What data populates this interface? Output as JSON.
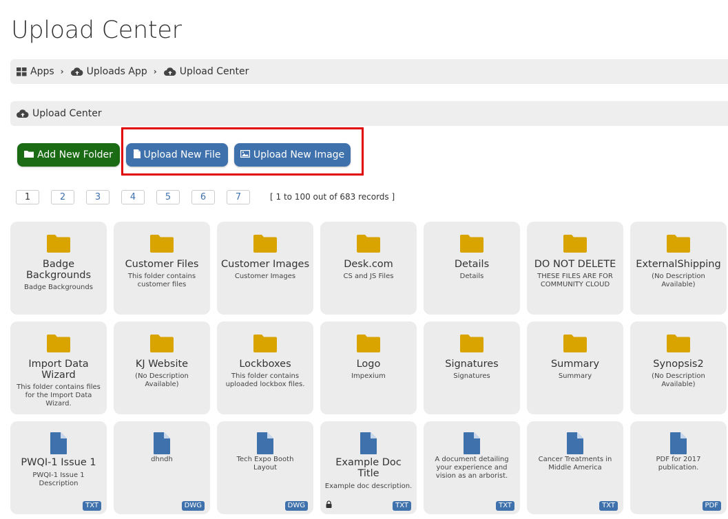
{
  "page": {
    "title": "Upload Center"
  },
  "breadcrumb": [
    {
      "label": "Apps",
      "icon": "grid-icon"
    },
    {
      "label": "Uploads App",
      "icon": "cloud-upload-icon"
    },
    {
      "label": "Upload Center",
      "icon": "cloud-upload-icon"
    }
  ],
  "subheader": {
    "label": "Upload Center",
    "icon": "cloud-upload-icon"
  },
  "actions": {
    "add_folder": "Add New Folder",
    "upload_file": "Upload New File",
    "upload_image": "Upload New Image"
  },
  "pagination": {
    "pages": [
      "1",
      "2",
      "3",
      "4",
      "5",
      "6",
      "7"
    ],
    "current": "1",
    "records": "[ 1 to 100 out of 683 records ]"
  },
  "folders": [
    {
      "name": "Badge Backgrounds",
      "desc": "Badge Backgrounds"
    },
    {
      "name": "Customer Files",
      "desc": "This folder contains customer files"
    },
    {
      "name": "Customer Images",
      "desc": "Customer Images"
    },
    {
      "name": "Desk.com",
      "desc": "CS and JS Files"
    },
    {
      "name": "Details",
      "desc": "Details"
    },
    {
      "name": "DO NOT DELETE",
      "desc": "THESE FILES ARE FOR COMMUNITY CLOUD"
    },
    {
      "name": "ExternalShipping",
      "desc": "(No Description Available)"
    },
    {
      "name": "Import Data Wizard",
      "desc": "This folder contains files for the Import Data Wizard."
    },
    {
      "name": "KJ Website",
      "desc": "(No Description Available)"
    },
    {
      "name": "Lockboxes",
      "desc": "This folder contains uploaded lockbox files."
    },
    {
      "name": "Logo",
      "desc": "Impexium"
    },
    {
      "name": "Signatures",
      "desc": "Signatures"
    },
    {
      "name": "Summary",
      "desc": "Summary"
    },
    {
      "name": "Synopsis2",
      "desc": "(No Description Available)"
    }
  ],
  "files": [
    {
      "name": "PWQI-1 Issue 1",
      "desc": "PWQI-1 Issue 1 Description",
      "type": "TXT",
      "locked": false
    },
    {
      "name": "",
      "desc": "dhndh",
      "type": "DWG",
      "locked": false
    },
    {
      "name": "",
      "desc": "Tech Expo Booth Layout",
      "type": "DWG",
      "locked": false
    },
    {
      "name": "Example Doc Title",
      "desc": "Example doc description.",
      "type": "TXT",
      "locked": true
    },
    {
      "name": "",
      "desc": "A document detailing your experience and vision as an arborist.",
      "type": "TXT",
      "locked": false
    },
    {
      "name": "",
      "desc": "Cancer Treatments in Middle America",
      "type": "TXT",
      "locked": false
    },
    {
      "name": "",
      "desc": "PDF for 2017 publication.",
      "type": "PDF",
      "locked": false
    }
  ],
  "colors": {
    "folder": "#d9a400",
    "doc": "#3f71ad",
    "green": "#1a6b14",
    "blue": "#3f71ad",
    "highlight": "#e00000"
  }
}
